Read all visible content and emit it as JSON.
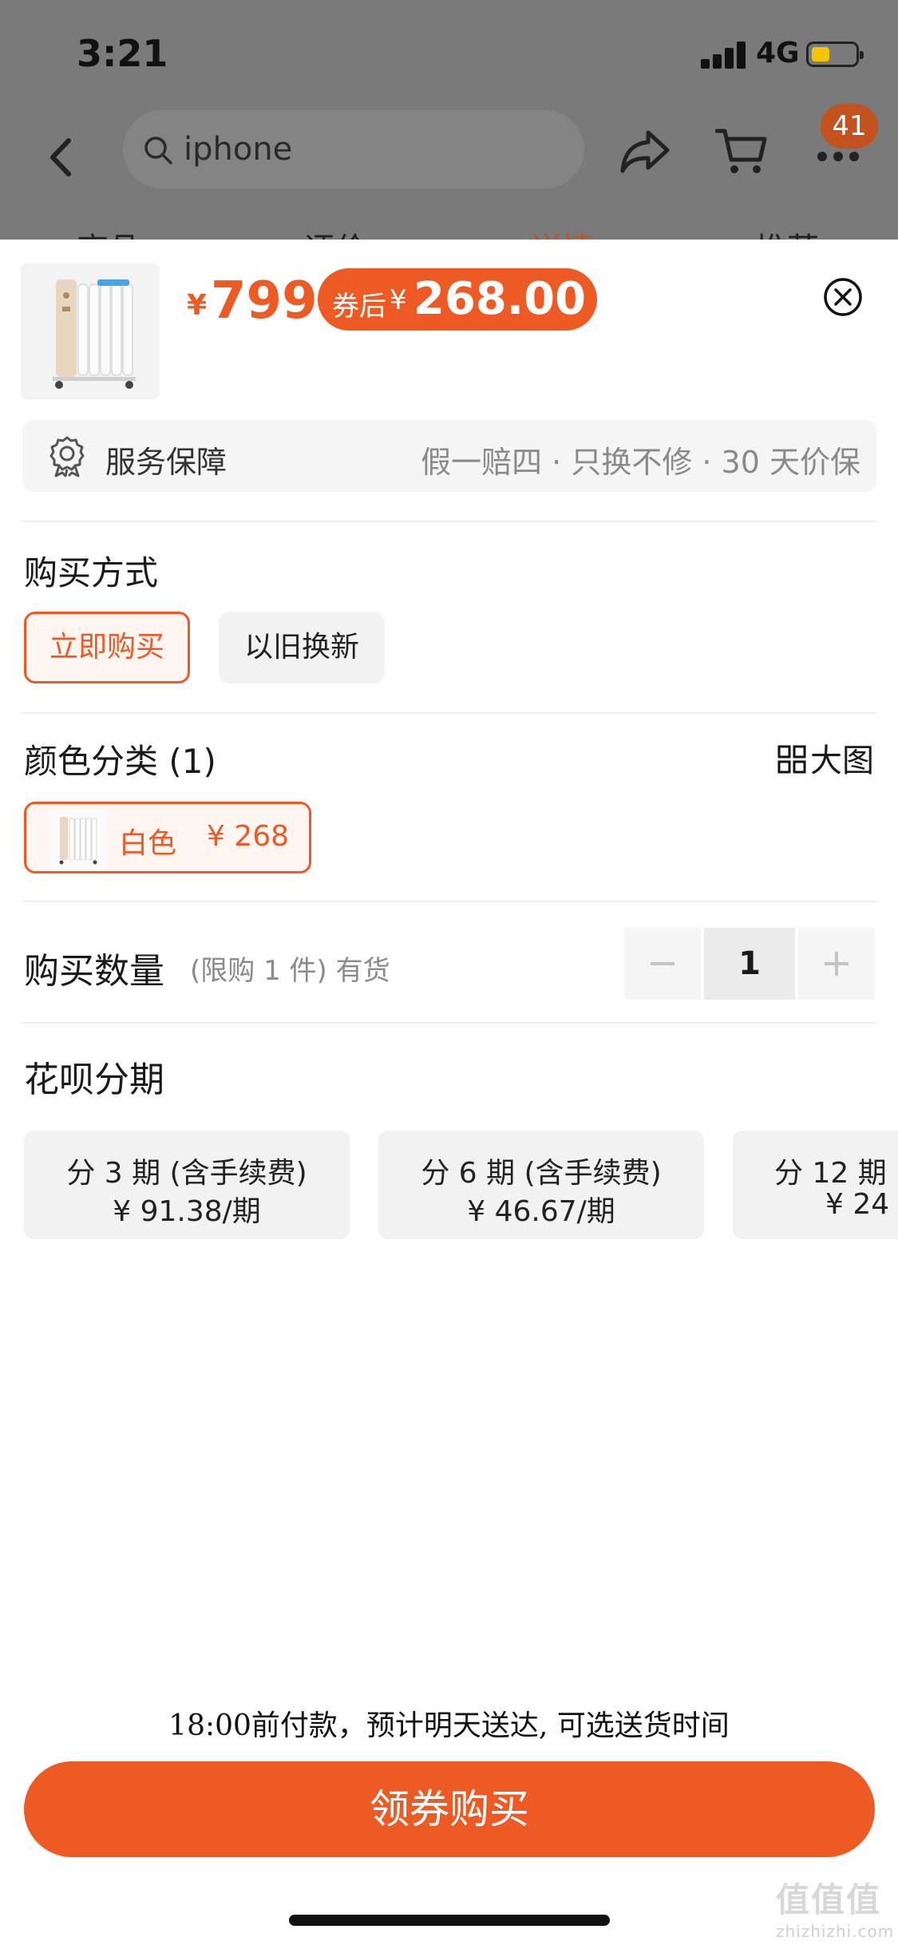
{
  "status_bar": {
    "time": "3:21",
    "network": "4G"
  },
  "nav": {
    "search_value": "iphone",
    "cart_badge": "41"
  },
  "bg_tabs": [
    "商品",
    "评价",
    "详情",
    "推荐"
  ],
  "product": {
    "price_symbol": "¥",
    "price": "799",
    "coupon_label": "券后",
    "coupon_symbol": "¥",
    "coupon_price": "268.00"
  },
  "service": {
    "title": "服务保障",
    "desc": "假一赔四 · 只换不修 · 30 天价保"
  },
  "purchase_method": {
    "title": "购买方式",
    "options": [
      "立即购买",
      "以旧换新"
    ],
    "selected": "立即购买"
  },
  "color": {
    "title": "颜色分类 (1)",
    "bigpic_label": "大图",
    "options": [
      {
        "name": "白色",
        "price": "¥ 268"
      }
    ]
  },
  "quantity": {
    "title": "购买数量",
    "note": "(限购 1 件) 有货",
    "value": "1",
    "minus": "−",
    "plus": "+"
  },
  "installments": {
    "title": "花呗分期",
    "plans": [
      {
        "term": "分 3 期 (含手续费)",
        "price": "¥ 91.38/期"
      },
      {
        "term": "分 6 期 (含手续费)",
        "price": "¥ 46.67/期"
      },
      {
        "term": "分 12 期",
        "price": "¥ 24"
      }
    ]
  },
  "delivery_note": "18:00前付款，预计明天送达, 可选送货时间",
  "buy_button": "领券购买",
  "watermark": {
    "logo": "值值值",
    "text": "zhizhizhi.com"
  },
  "colors": {
    "accent": "#ee5a24",
    "dim_overlay": "#7a7a7a"
  }
}
